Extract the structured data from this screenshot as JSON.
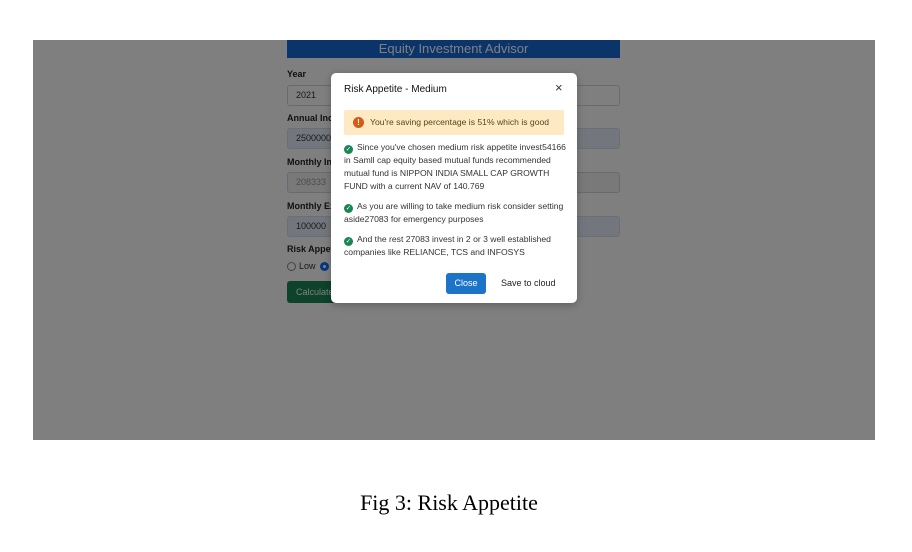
{
  "app": {
    "title": "Equity Investment Advisor"
  },
  "form": {
    "year_label": "Year",
    "year_value": "2021",
    "annual_income_label": "Annual Inc",
    "annual_income_value": "2500000",
    "monthly_income_label": "Monthly In",
    "monthly_income_value": "208333",
    "monthly_expense_label": "Monthly Ex",
    "monthly_expense_value": "100000",
    "risk_label": "Risk Appeti",
    "risk_low_label": "Low",
    "calculate_label": "Calculate"
  },
  "modal": {
    "title": "Risk Appetite - Medium",
    "close_glyph": "×",
    "alert_text": "You're saving percentage is 51% which is good",
    "items": [
      "Since you've chosen medium risk appetite invest54166 in Samll cap equity based mutual funds recommended mutual fund is NIPPON INDIA SMALL CAP GROWTH FUND with a current NAV of 140.769",
      "As you are willing to take medium risk consider setting aside27083 for emergency purposes",
      "And the rest 27083 invest in 2 or 3 well established companies like RELIANCE, TCS and INFOSYS"
    ],
    "close_button": "Close",
    "save_button": "Save to cloud"
  },
  "icons": {
    "alert": "exclamation-circle-icon",
    "check": "check-circle-icon"
  },
  "colors": {
    "primary": "#1769d6",
    "success": "#198754",
    "warning_bg": "#fde9c4"
  },
  "caption": "Fig 3: Risk Appetite"
}
